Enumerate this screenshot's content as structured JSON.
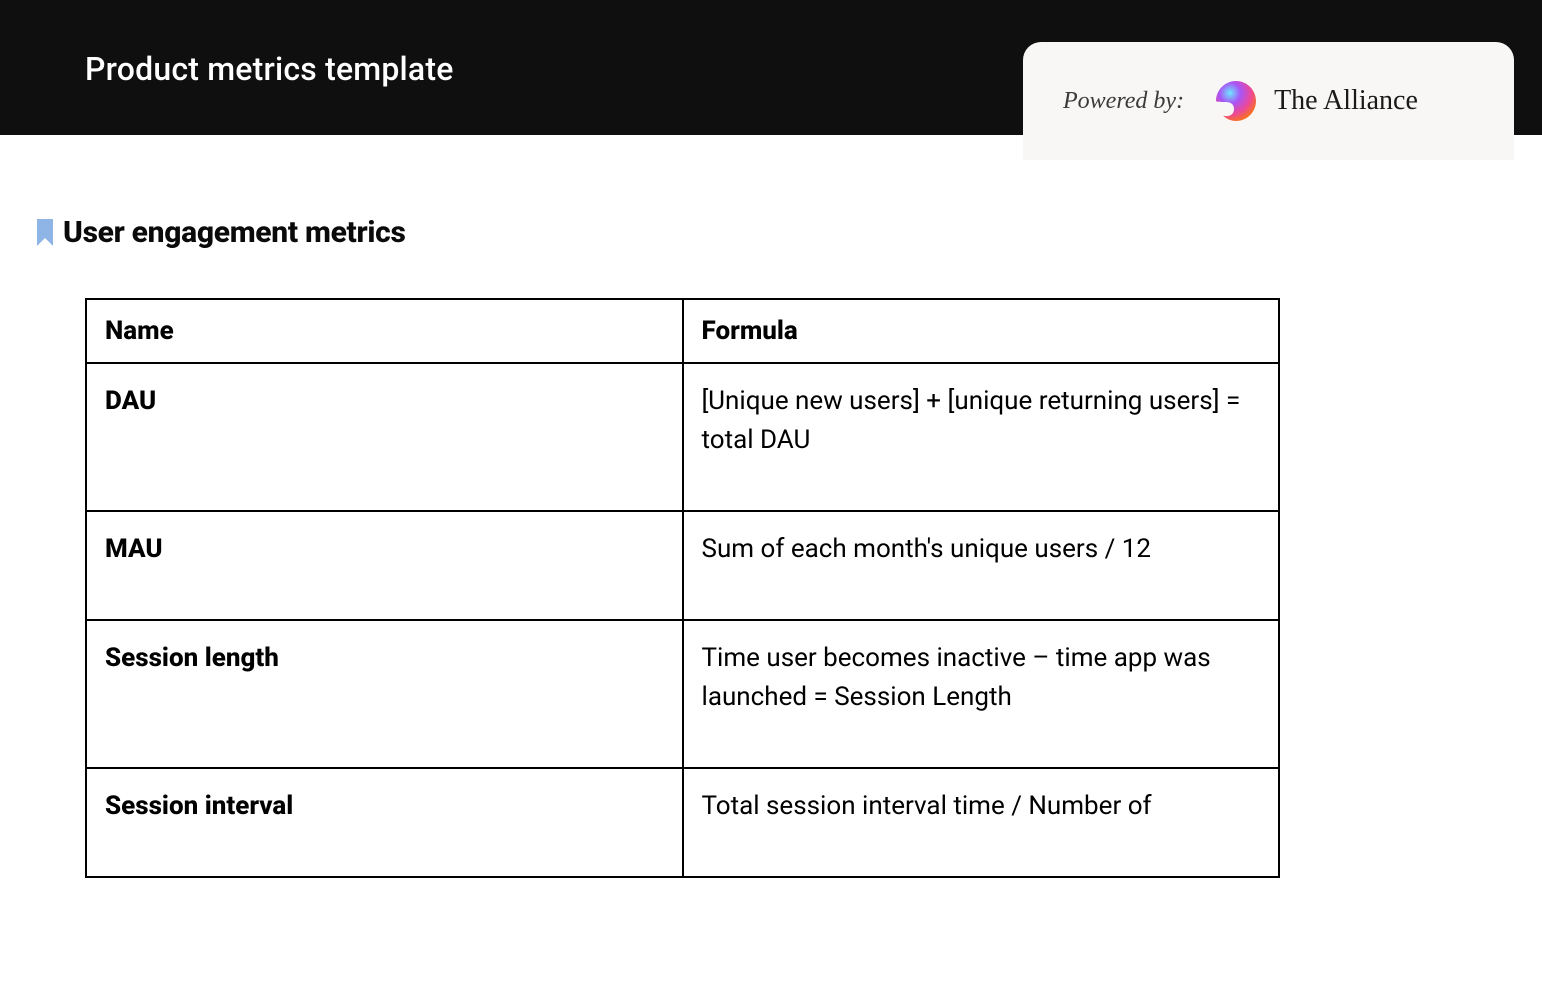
{
  "header": {
    "title": "Product metrics template",
    "powered_by_label": "Powered by:",
    "brand": "The Alliance"
  },
  "section": {
    "title": "User engagement metrics"
  },
  "table": {
    "columns": {
      "name": "Name",
      "formula": "Formula"
    },
    "rows": [
      {
        "name": "DAU",
        "formula": "[Unique new users] + [unique returning users] = total DAU"
      },
      {
        "name": "MAU",
        "formula": "Sum of each month's unique users / 12"
      },
      {
        "name": "Session length",
        "formula": "Time user becomes inactive – time app was launched = Session Length"
      },
      {
        "name": "Session interval",
        "formula": "Total session interval time / Number of"
      }
    ]
  }
}
